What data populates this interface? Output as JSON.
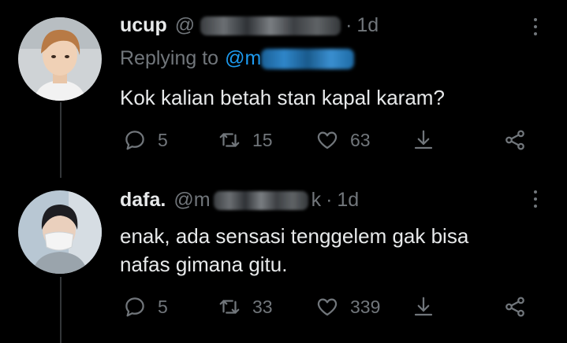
{
  "tweets": [
    {
      "name": "ucup",
      "handle_prefix": "@",
      "handle_suffix": "",
      "separator": "·",
      "time": "1d",
      "replying_label": "Replying to",
      "replying_mention": "@m",
      "text_lines": [
        "Kok kalian betah stan kapal karam?"
      ],
      "counts": {
        "replies": "5",
        "retweets": "15",
        "likes": "63"
      }
    },
    {
      "name": "dafa.",
      "handle_prefix": "@m",
      "handle_suffix": "k",
      "separator": "·",
      "time": "1d",
      "text_lines": [
        "enak, ada sensasi tenggelem gak bisa",
        "nafas gimana gitu."
      ],
      "counts": {
        "replies": "5",
        "retweets": "33",
        "likes": "339"
      }
    }
  ],
  "colors": {
    "background": "#000000",
    "text": "#e7e9ea",
    "secondary": "#71767b",
    "link": "#1d9bf0",
    "thread_line": "#333639"
  },
  "icons": [
    "reply-icon",
    "retweet-icon",
    "like-icon",
    "share-icon",
    "more-options-icon",
    "network-icon"
  ]
}
